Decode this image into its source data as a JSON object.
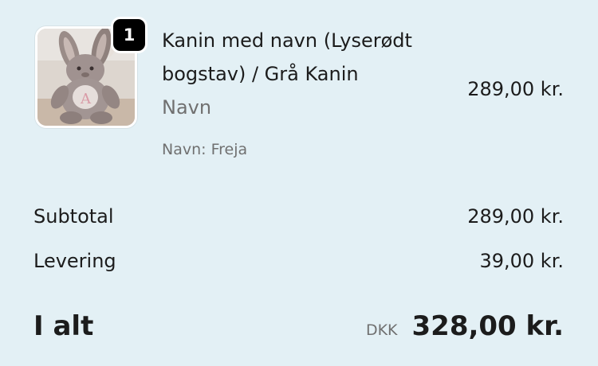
{
  "line_item": {
    "quantity": "1",
    "title": "Kanin med navn (Lyserødt bogstav) / Grå Kanin",
    "title_line1": "Kanin med navn (Lyserødt",
    "title_line2": "bogstav) / Grå Kanin",
    "variant": "Navn",
    "property": "Navn: Freja",
    "price": "289,00 kr.",
    "image_icon": "plush-rabbit-photo"
  },
  "summary": {
    "subtotal_label": "Subtotal",
    "subtotal_value": "289,00 kr.",
    "shipping_label": "Levering",
    "shipping_value": "39,00 kr.",
    "total_label": "I alt",
    "currency_code": "DKK",
    "total_value": "328,00 kr."
  },
  "colors": {
    "background": "#e3f0f5",
    "text": "#1c1c1c",
    "muted_text": "#707070",
    "badge_background": "#000000"
  }
}
